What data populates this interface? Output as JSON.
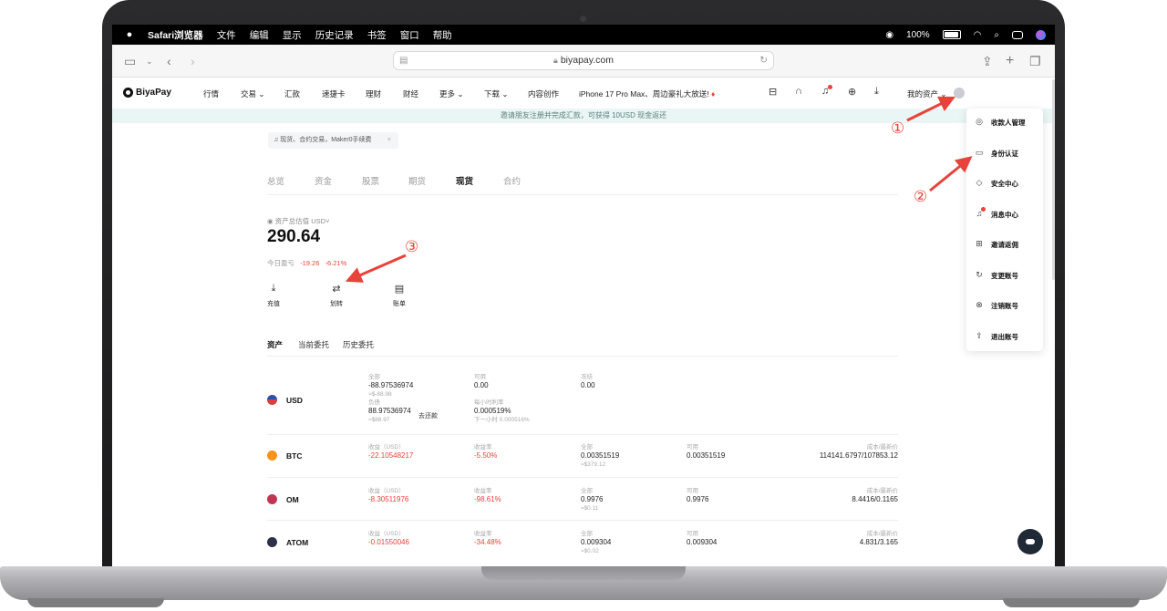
{
  "menubar": {
    "app": "Safari浏览器",
    "items": [
      "文件",
      "编辑",
      "显示",
      "历史记录",
      "书签",
      "窗口",
      "帮助"
    ],
    "battery": "100%"
  },
  "browser": {
    "url": "biyapay.com"
  },
  "site": {
    "brand": "BiyaPay",
    "nav": [
      "行情",
      "交易",
      "汇款",
      "速捷卡",
      "理财",
      "财经",
      "更多",
      "下载",
      "内容创作"
    ],
    "promo": "iPhone 17 Pro Max、周边豪礼大放送!",
    "my_assets": "我的资产",
    "banner": "邀请朋友注册并完成汇款，可获得 10USD 现金返还"
  },
  "notice": "现货、合约交易，Maker0手续费",
  "tabs": [
    "总览",
    "资金",
    "股票",
    "期货",
    "现货",
    "合约"
  ],
  "active_tab": "现货",
  "overview": {
    "est_label": "资产总估值",
    "currency": "USD",
    "total": "290.64",
    "pnl_label": "今日盈亏",
    "pnl_value": "-19.26",
    "pnl_rate": "-6.21%"
  },
  "actions": [
    "充值",
    "划转",
    "账单"
  ],
  "subtabs": [
    "资产",
    "当前委托",
    "历史委托"
  ],
  "usd": {
    "name": "USD",
    "total_label": "全部",
    "total": "-88.97536974",
    "total_sub": "≈$-88.98",
    "debt_label": "负债",
    "debt": "88.97536974",
    "debt_sub": "≈$88.97",
    "repay": "去还款",
    "avail_label": "可用",
    "avail": "0.00",
    "rate_label": "每小时利率",
    "rate": "0.000519%",
    "rate_sub": "下一小时 0.000516%",
    "frozen_label": "冻结",
    "frozen": "0.00"
  },
  "labels": {
    "profit": "收益（USD）",
    "profit_rate": "收益率",
    "total": "全部",
    "avail": "可用",
    "cost": "成本/最新价"
  },
  "assets": [
    {
      "name": "BTC",
      "color": "#f7931a",
      "profit": "-22.10548217",
      "rate": "-5.50%",
      "total": "0.00351519",
      "total_sub": "≈$379.12",
      "avail": "0.00351519",
      "cost": "114141.6797/107853.12"
    },
    {
      "name": "OM",
      "color": "#c0354f",
      "profit": "-8.30511976",
      "rate": "-98.61%",
      "total": "0.9976",
      "total_sub": "≈$0.11",
      "avail": "0.9976",
      "cost": "8.4416/0.1165"
    },
    {
      "name": "ATOM",
      "color": "#2e3148",
      "profit": "-0.01550046",
      "rate": "-34.48%",
      "total": "0.009304",
      "total_sub": "≈$0.02",
      "avail": "0.009304",
      "cost": "4.831/3.165"
    }
  ],
  "dropdown": [
    {
      "label": "收款人管理",
      "icon": "user-circle-icon"
    },
    {
      "label": "身份认证",
      "icon": "id-card-icon"
    },
    {
      "label": "安全中心",
      "icon": "shield-icon"
    },
    {
      "label": "消息中心",
      "icon": "bell-icon"
    },
    {
      "label": "邀请返佣",
      "icon": "gift-icon"
    },
    {
      "label": "变更账号",
      "icon": "refresh-icon"
    },
    {
      "label": "注销账号",
      "icon": "close-circle-icon"
    },
    {
      "label": "退出账号",
      "icon": "logout-icon"
    }
  ],
  "annotations": [
    "①",
    "②",
    "③"
  ],
  "colors": {
    "accent_red": "#e8433a",
    "banner_bg": "#e9f6f5"
  }
}
